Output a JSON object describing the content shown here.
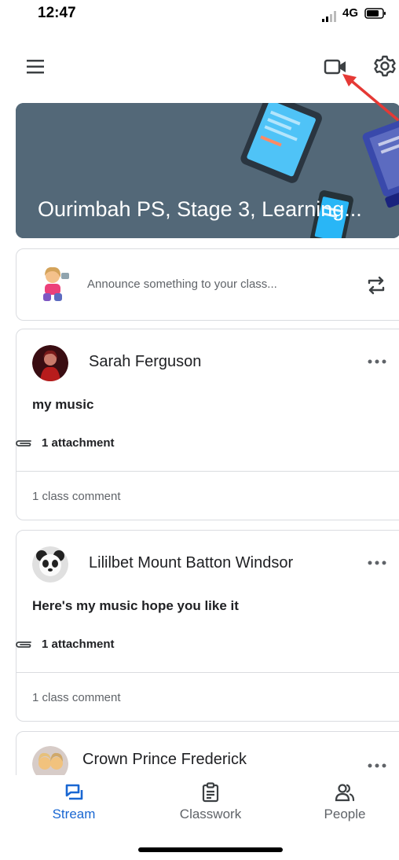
{
  "status_bar": {
    "time": "12:47",
    "network": "4G"
  },
  "class_banner": {
    "title": "Ourimbah PS, Stage 3, Learning..."
  },
  "announce": {
    "placeholder": "Announce something to your class..."
  },
  "posts": [
    {
      "author": "Sarah Ferguson",
      "body": "my music",
      "attachments": "1 attachment",
      "comments": "1 class comment"
    },
    {
      "author": "Lililbet Mount Batton Windsor",
      "body": "Here's my music hope you like it",
      "attachments": "1 attachment",
      "comments": "1 class comment"
    },
    {
      "author": "Crown Prince Frederick"
    }
  ],
  "bottom_nav": [
    {
      "label": "Stream",
      "icon": "stream-icon",
      "active": true
    },
    {
      "label": "Classwork",
      "icon": "classwork-icon",
      "active": false
    },
    {
      "label": "People",
      "icon": "people-icon",
      "active": false
    }
  ],
  "colors": {
    "accent": "#1967d2",
    "banner": "#536878",
    "annotation": "#e53935"
  }
}
